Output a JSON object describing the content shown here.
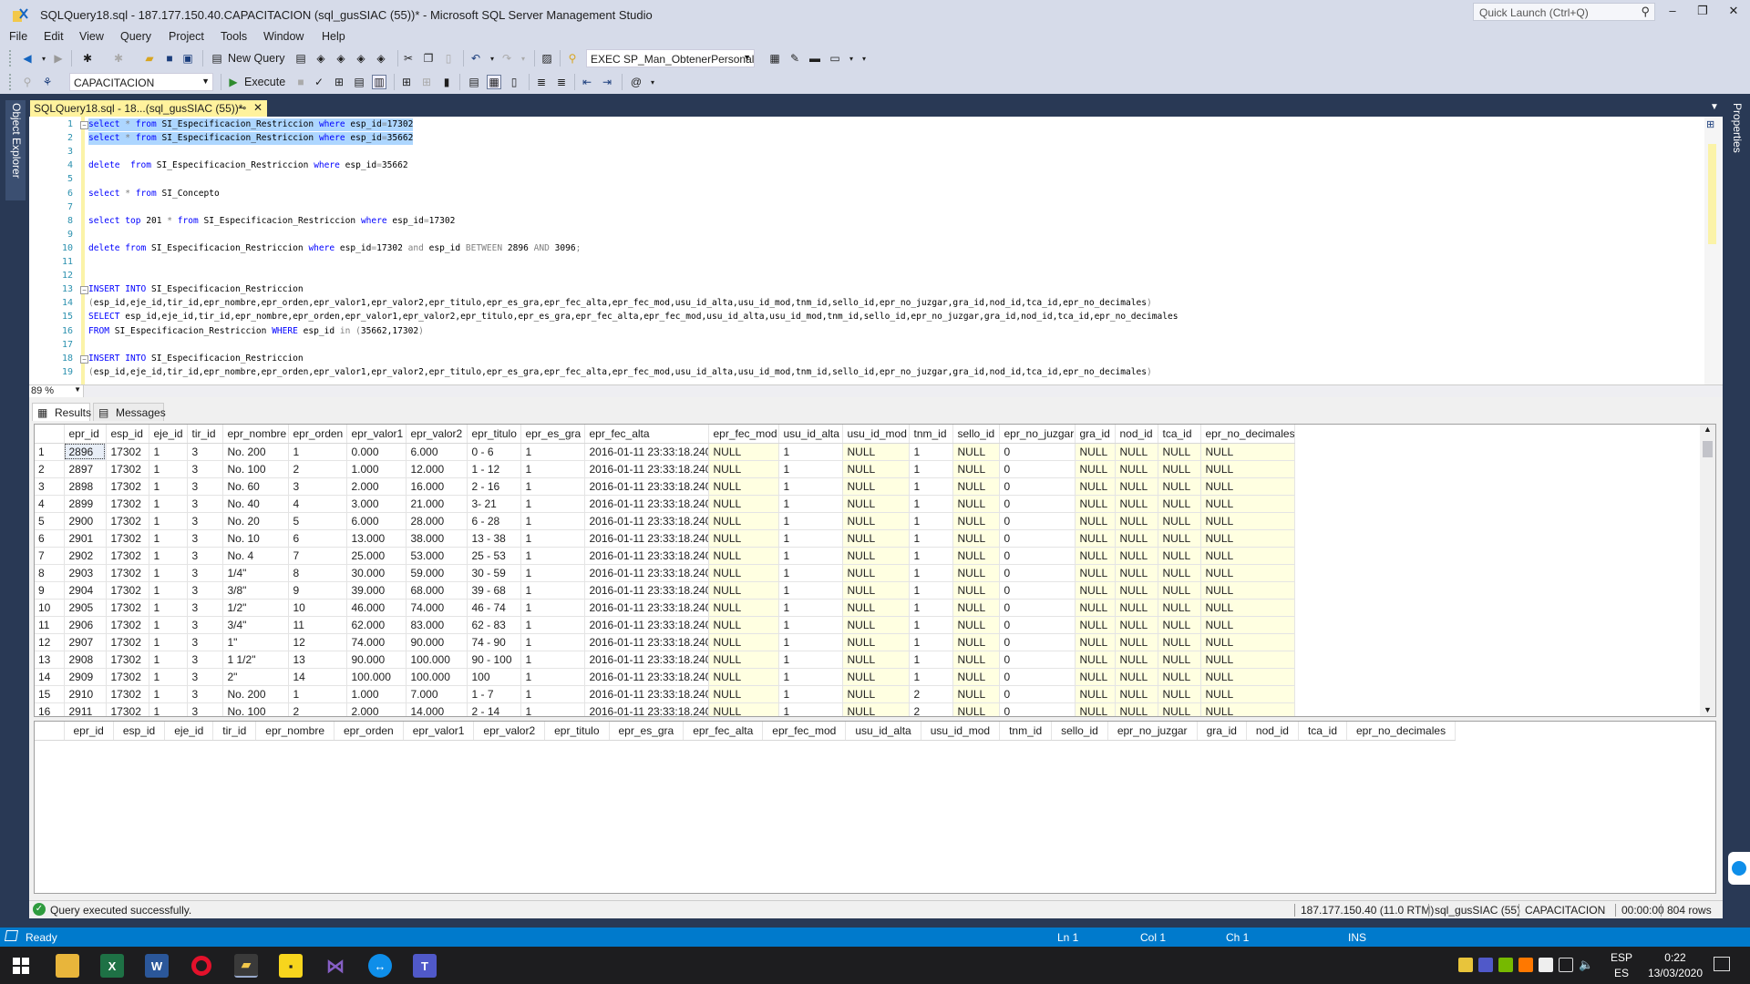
{
  "window": {
    "title": "SQLQuery18.sql - 187.177.150.40.CAPACITACION (sql_gusSIAC (55))* - Microsoft SQL Server Management Studio",
    "quick_launch_placeholder": "Quick Launch (Ctrl+Q)",
    "controls": {
      "minimize": "–",
      "restore": "❐",
      "close": "✕"
    }
  },
  "menu": [
    "File",
    "Edit",
    "View",
    "Query",
    "Project",
    "Tools",
    "Window",
    "Help"
  ],
  "toolbar": {
    "new_query": "New Query",
    "exec_combo": "EXEC SP_Man_ObtenerPersonalI",
    "database_combo": "CAPACITACION",
    "execute": "Execute"
  },
  "side_tabs": {
    "left": "Object Explorer",
    "right": "Properties"
  },
  "doc_tab": {
    "label": "SQLQuery18.sql - 18...(sql_gusSIAC (55))*",
    "pin": "⊸",
    "close": "✕",
    "accent": "#fff29d"
  },
  "editor": {
    "zoom": "89 %",
    "lines": [
      {
        "n": "1",
        "fold": true,
        "selected": true,
        "tokens": [
          [
            "kw",
            "select"
          ],
          [
            "id",
            " "
          ],
          [
            "op",
            "*"
          ],
          [
            "id",
            " "
          ],
          [
            "kw",
            "from"
          ],
          [
            "id",
            " SI_Especificacion_Restriccion "
          ],
          [
            "kw",
            "where"
          ],
          [
            "id",
            " esp_id"
          ],
          [
            "op",
            "="
          ],
          [
            "id",
            "17302"
          ]
        ]
      },
      {
        "n": "2",
        "selected": true,
        "tokens": [
          [
            "kw",
            "select"
          ],
          [
            "id",
            " "
          ],
          [
            "op",
            "*"
          ],
          [
            "id",
            " "
          ],
          [
            "kw",
            "from"
          ],
          [
            "id",
            " SI_Especificacion_Restriccion "
          ],
          [
            "kw",
            "where"
          ],
          [
            "id",
            " esp_id"
          ],
          [
            "op",
            "="
          ],
          [
            "id",
            "35662"
          ]
        ]
      },
      {
        "n": "3",
        "tokens": []
      },
      {
        "n": "4",
        "tokens": [
          [
            "kw",
            "delete"
          ],
          [
            "id",
            "  "
          ],
          [
            "kw",
            "from"
          ],
          [
            "id",
            " SI_Especificacion_Restriccion "
          ],
          [
            "kw",
            "where"
          ],
          [
            "id",
            " esp_id"
          ],
          [
            "op",
            "="
          ],
          [
            "id",
            "35662"
          ]
        ]
      },
      {
        "n": "5",
        "tokens": []
      },
      {
        "n": "6",
        "tokens": [
          [
            "kw",
            "select"
          ],
          [
            "id",
            " "
          ],
          [
            "op",
            "*"
          ],
          [
            "id",
            " "
          ],
          [
            "kw",
            "from"
          ],
          [
            "id",
            " SI_Concepto"
          ]
        ]
      },
      {
        "n": "7",
        "tokens": []
      },
      {
        "n": "8",
        "tokens": [
          [
            "kw",
            "select"
          ],
          [
            "id",
            " "
          ],
          [
            "kw",
            "top"
          ],
          [
            "id",
            " 201 "
          ],
          [
            "op",
            "*"
          ],
          [
            "id",
            " "
          ],
          [
            "kw",
            "from"
          ],
          [
            "id",
            " SI_Especificacion_Restriccion "
          ],
          [
            "kw",
            "where"
          ],
          [
            "id",
            " esp_id"
          ],
          [
            "op",
            "="
          ],
          [
            "id",
            "17302"
          ]
        ]
      },
      {
        "n": "9",
        "tokens": []
      },
      {
        "n": "10",
        "tokens": [
          [
            "kw",
            "delete"
          ],
          [
            "id",
            " "
          ],
          [
            "kw",
            "from"
          ],
          [
            "id",
            " SI_Especificacion_Restriccion "
          ],
          [
            "kw",
            "where"
          ],
          [
            "id",
            " esp_id"
          ],
          [
            "op",
            "="
          ],
          [
            "id",
            "17302 "
          ],
          [
            "op",
            "and"
          ],
          [
            "id",
            " esp_id "
          ],
          [
            "op",
            "BETWEEN"
          ],
          [
            "id",
            " 2896 "
          ],
          [
            "op",
            "AND"
          ],
          [
            "id",
            " 3096"
          ],
          [
            "op",
            ";"
          ]
        ]
      },
      {
        "n": "11",
        "tokens": []
      },
      {
        "n": "12",
        "tokens": []
      },
      {
        "n": "13",
        "fold": true,
        "tokens": [
          [
            "kw",
            "INSERT"
          ],
          [
            "id",
            " "
          ],
          [
            "kw",
            "INTO"
          ],
          [
            "id",
            " SI_Especificacion_Restriccion"
          ]
        ]
      },
      {
        "n": "14",
        "tokens": [
          [
            "op",
            "("
          ],
          [
            "id",
            "esp_id,eje_id,tir_id,epr_nombre,epr_orden,epr_valor1,epr_valor2,epr_titulo,epr_es_gra,epr_fec_alta,epr_fec_mod,usu_id_alta,usu_id_mod,tnm_id,sello_id,epr_no_juzgar,gra_id,nod_id,tca_id,epr_no_decimales"
          ],
          [
            "op",
            ")"
          ]
        ]
      },
      {
        "n": "15",
        "tokens": [
          [
            "kw",
            "SELECT"
          ],
          [
            "id",
            " esp_id,eje_id,tir_id,epr_nombre,epr_orden,epr_valor1,epr_valor2,epr_titulo,epr_es_gra,epr_fec_alta,epr_fec_mod,usu_id_alta,usu_id_mod,tnm_id,sello_id,epr_no_juzgar,gra_id,nod_id,tca_id,epr_no_decimales"
          ]
        ]
      },
      {
        "n": "16",
        "tokens": [
          [
            "kw",
            "FROM"
          ],
          [
            "id",
            " SI_Especificacion_Restriccion "
          ],
          [
            "kw",
            "WHERE"
          ],
          [
            "id",
            " esp_id "
          ],
          [
            "op",
            "in"
          ],
          [
            "id",
            " "
          ],
          [
            "op",
            "("
          ],
          [
            "id",
            "35662,17302"
          ],
          [
            "op",
            ")"
          ]
        ]
      },
      {
        "n": "17",
        "tokens": []
      },
      {
        "n": "18",
        "fold": true,
        "tokens": [
          [
            "kw",
            "INSERT"
          ],
          [
            "id",
            " "
          ],
          [
            "kw",
            "INTO"
          ],
          [
            "id",
            " SI_Especificacion_Restriccion"
          ]
        ]
      },
      {
        "n": "19",
        "tokens": [
          [
            "op",
            "("
          ],
          [
            "id",
            "esp_id,eje_id,tir_id,epr_nombre,epr_orden,epr_valor1,epr_valor2,epr_titulo,epr_es_gra,epr_fec_alta,epr_fec_mod,usu_id_alta,usu_id_mod,tnm_id,sello_id,epr_no_juzgar,gra_id,nod_id,tca_id,epr_no_decimales"
          ],
          [
            "op",
            ")"
          ]
        ]
      }
    ]
  },
  "results": {
    "tabs": [
      "Results",
      "Messages"
    ],
    "grid1": {
      "columns": [
        "epr_id",
        "esp_id",
        "eje_id",
        "tir_id",
        "epr_nombre",
        "epr_orden",
        "epr_valor1",
        "epr_valor2",
        "epr_titulo",
        "epr_es_gra",
        "epr_fec_alta",
        "epr_fec_mod",
        "usu_id_alta",
        "usu_id_mod",
        "tnm_id",
        "sello_id",
        "epr_no_juzgar",
        "gra_id",
        "nod_id",
        "tca_id",
        "epr_no_decimales"
      ],
      "rows": [
        [
          "2896",
          "17302",
          "1",
          "3",
          "No. 200",
          "1",
          "0.000",
          "6.000",
          "0 - 6",
          "1",
          "2016-01-11 23:33:18.240",
          "NULL",
          "1",
          "NULL",
          "1",
          "NULL",
          "0",
          "NULL",
          "NULL",
          "NULL",
          "NULL"
        ],
        [
          "2897",
          "17302",
          "1",
          "3",
          "No. 100",
          "2",
          "1.000",
          "12.000",
          "1 - 12",
          "1",
          "2016-01-11 23:33:18.240",
          "NULL",
          "1",
          "NULL",
          "1",
          "NULL",
          "0",
          "NULL",
          "NULL",
          "NULL",
          "NULL"
        ],
        [
          "2898",
          "17302",
          "1",
          "3",
          "No. 60",
          "3",
          "2.000",
          "16.000",
          "2 - 16",
          "1",
          "2016-01-11 23:33:18.240",
          "NULL",
          "1",
          "NULL",
          "1",
          "NULL",
          "0",
          "NULL",
          "NULL",
          "NULL",
          "NULL"
        ],
        [
          "2899",
          "17302",
          "1",
          "3",
          "No. 40",
          "4",
          "3.000",
          "21.000",
          "3- 21",
          "1",
          "2016-01-11 23:33:18.240",
          "NULL",
          "1",
          "NULL",
          "1",
          "NULL",
          "0",
          "NULL",
          "NULL",
          "NULL",
          "NULL"
        ],
        [
          "2900",
          "17302",
          "1",
          "3",
          "No. 20",
          "5",
          "6.000",
          "28.000",
          "6 - 28",
          "1",
          "2016-01-11 23:33:18.240",
          "NULL",
          "1",
          "NULL",
          "1",
          "NULL",
          "0",
          "NULL",
          "NULL",
          "NULL",
          "NULL"
        ],
        [
          "2901",
          "17302",
          "1",
          "3",
          "No. 10",
          "6",
          "13.000",
          "38.000",
          "13 - 38",
          "1",
          "2016-01-11 23:33:18.240",
          "NULL",
          "1",
          "NULL",
          "1",
          "NULL",
          "0",
          "NULL",
          "NULL",
          "NULL",
          "NULL"
        ],
        [
          "2902",
          "17302",
          "1",
          "3",
          "No. 4",
          "7",
          "25.000",
          "53.000",
          "25 - 53",
          "1",
          "2016-01-11 23:33:18.240",
          "NULL",
          "1",
          "NULL",
          "1",
          "NULL",
          "0",
          "NULL",
          "NULL",
          "NULL",
          "NULL"
        ],
        [
          "2903",
          "17302",
          "1",
          "3",
          "1/4\"",
          "8",
          "30.000",
          "59.000",
          "30 - 59",
          "1",
          "2016-01-11 23:33:18.240",
          "NULL",
          "1",
          "NULL",
          "1",
          "NULL",
          "0",
          "NULL",
          "NULL",
          "NULL",
          "NULL"
        ],
        [
          "2904",
          "17302",
          "1",
          "3",
          "3/8\"",
          "9",
          "39.000",
          "68.000",
          "39 - 68",
          "1",
          "2016-01-11 23:33:18.240",
          "NULL",
          "1",
          "NULL",
          "1",
          "NULL",
          "0",
          "NULL",
          "NULL",
          "NULL",
          "NULL"
        ],
        [
          "2905",
          "17302",
          "1",
          "3",
          "1/2\"",
          "10",
          "46.000",
          "74.000",
          "46 - 74",
          "1",
          "2016-01-11 23:33:18.240",
          "NULL",
          "1",
          "NULL",
          "1",
          "NULL",
          "0",
          "NULL",
          "NULL",
          "NULL",
          "NULL"
        ],
        [
          "2906",
          "17302",
          "1",
          "3",
          "3/4\"",
          "11",
          "62.000",
          "83.000",
          "62 - 83",
          "1",
          "2016-01-11 23:33:18.240",
          "NULL",
          "1",
          "NULL",
          "1",
          "NULL",
          "0",
          "NULL",
          "NULL",
          "NULL",
          "NULL"
        ],
        [
          "2907",
          "17302",
          "1",
          "3",
          "1\"",
          "12",
          "74.000",
          "90.000",
          "74 - 90",
          "1",
          "2016-01-11 23:33:18.240",
          "NULL",
          "1",
          "NULL",
          "1",
          "NULL",
          "0",
          "NULL",
          "NULL",
          "NULL",
          "NULL"
        ],
        [
          "2908",
          "17302",
          "1",
          "3",
          "1 1/2\"",
          "13",
          "90.000",
          "100.000",
          "90 - 100",
          "1",
          "2016-01-11 23:33:18.240",
          "NULL",
          "1",
          "NULL",
          "1",
          "NULL",
          "0",
          "NULL",
          "NULL",
          "NULL",
          "NULL"
        ],
        [
          "2909",
          "17302",
          "1",
          "3",
          "2\"",
          "14",
          "100.000",
          "100.000",
          "100",
          "1",
          "2016-01-11 23:33:18.240",
          "NULL",
          "1",
          "NULL",
          "1",
          "NULL",
          "0",
          "NULL",
          "NULL",
          "NULL",
          "NULL"
        ],
        [
          "2910",
          "17302",
          "1",
          "3",
          "No. 200",
          "1",
          "1.000",
          "7.000",
          "1 - 7",
          "1",
          "2016-01-11 23:33:18.240",
          "NULL",
          "1",
          "NULL",
          "2",
          "NULL",
          "0",
          "NULL",
          "NULL",
          "NULL",
          "NULL"
        ],
        [
          "2911",
          "17302",
          "1",
          "3",
          "No. 100",
          "2",
          "2.000",
          "14.000",
          "2 - 14",
          "1",
          "2016-01-11 23:33:18.240",
          "NULL",
          "1",
          "NULL",
          "2",
          "NULL",
          "0",
          "NULL",
          "NULL",
          "NULL",
          "NULL"
        ]
      ]
    },
    "grid2": {
      "columns": [
        "epr_id",
        "esp_id",
        "eje_id",
        "tir_id",
        "epr_nombre",
        "epr_orden",
        "epr_valor1",
        "epr_valor2",
        "epr_titulo",
        "epr_es_gra",
        "epr_fec_alta",
        "epr_fec_mod",
        "usu_id_alta",
        "usu_id_mod",
        "tnm_id",
        "sello_id",
        "epr_no_juzgar",
        "gra_id",
        "nod_id",
        "tca_id",
        "epr_no_decimales"
      ]
    },
    "null_color": "#ffffe1"
  },
  "query_status": {
    "message": "Query executed successfully.",
    "server": "187.177.150.40 (11.0 RTM)",
    "user": "sql_gusSIAC (55)",
    "database": "CAPACITACION",
    "elapsed": "00:00:00",
    "rows": "804 rows"
  },
  "statusbar": {
    "ready": "Ready",
    "ln": "Ln 1",
    "col": "Col 1",
    "ch": "Ch 1",
    "ins": "INS",
    "color": "#007acc"
  },
  "taskbar": {
    "apps": [
      "windows-start",
      "file-explorer",
      "excel",
      "word",
      "opera",
      "ssms",
      "sticky-notes",
      "visual-studio",
      "teamviewer",
      "teams"
    ],
    "lang1": "ESP",
    "lang2": "ES",
    "time": "0:22",
    "date": "13/03/2020"
  }
}
